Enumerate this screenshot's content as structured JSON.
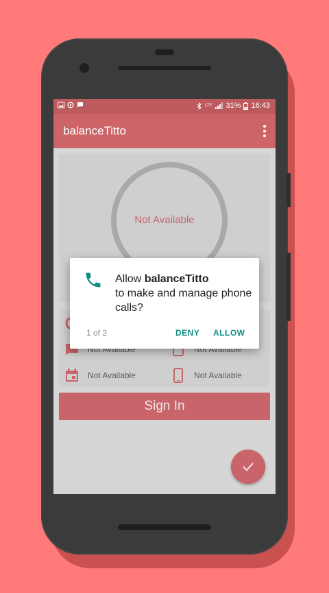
{
  "status_bar": {
    "battery_percent": "31%",
    "time": "16:43",
    "network_label": "LTE"
  },
  "app_bar": {
    "title": "balanceTitto"
  },
  "balance": {
    "value": "Not Available"
  },
  "stats": [
    {
      "icon": "sms-icon",
      "value": "Not Available"
    },
    {
      "icon": "device-icon",
      "value": "Not Available"
    },
    {
      "icon": "calendar-icon",
      "value": "Not Available"
    },
    {
      "icon": "phone-icon",
      "value": "Not Available"
    }
  ],
  "sign_in_button": "Sign In",
  "permission_dialog": {
    "prefix": "Allow ",
    "app_name": "balanceTitto",
    "message": "to make and manage phone calls?",
    "counter": "1 of 2",
    "deny_label": "DENY",
    "allow_label": "ALLOW"
  },
  "colors": {
    "background": "#ff7a79",
    "toolbar": "#cc6468",
    "accent": "#c8646a",
    "dialog_button": "#138f86"
  }
}
